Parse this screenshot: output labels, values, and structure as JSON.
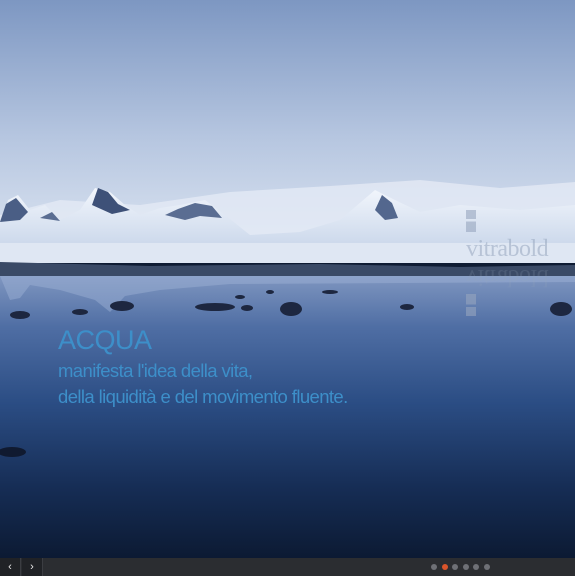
{
  "slide": {
    "logo_text": "vitrabold",
    "title": "ACQUA",
    "lines": [
      "manifesta l'idea della vita,",
      "della liquidità e del movimento fluente."
    ]
  },
  "controls": {
    "prev_icon": "‹",
    "next_icon": "›",
    "dots": [
      {
        "name": "slide-1",
        "active": false
      },
      {
        "name": "slide-2",
        "active": true
      },
      {
        "name": "slide-3",
        "active": false
      },
      {
        "name": "slide-4",
        "active": false
      },
      {
        "name": "slide-5",
        "active": false
      },
      {
        "name": "slide-6",
        "active": false
      }
    ]
  },
  "colors": {
    "caption": "#3d8fc9",
    "active_dot": "#d9542b",
    "inactive_dot": "#6e7076",
    "bar": "#2b2d31"
  }
}
